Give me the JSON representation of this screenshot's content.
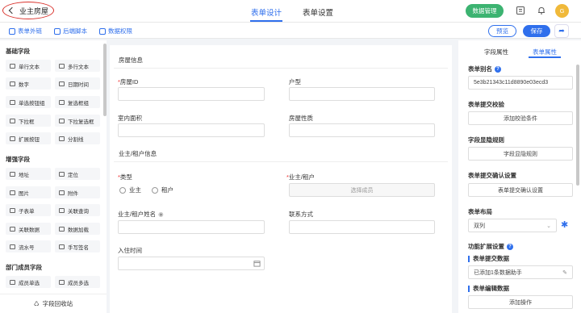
{
  "header": {
    "back_label": "业主房屋",
    "tab_form_design": "表单设计",
    "tab_form_settings": "表单设置",
    "data_mgmt": "数据管理",
    "avatar": "G"
  },
  "subbar": {
    "external_link": "表单外链",
    "backend_script": "后端脚本",
    "data_permission": "数据权限",
    "preview": "预览",
    "save": "保存"
  },
  "left": {
    "group_basic": "基础字段",
    "basic": [
      "单行文本",
      "多行文本",
      "数字",
      "日期时间",
      "单选按钮组",
      "复选框组",
      "下拉框",
      "下拉复选框",
      "扩展按钮",
      "分割线"
    ],
    "group_enhanced": "增强字段",
    "enhanced": [
      "地址",
      "定位",
      "图片",
      "附件",
      "子表单",
      "关联查询",
      "关联数据",
      "数据加载",
      "流水号",
      "手写签名"
    ],
    "group_member": "部门成员字段",
    "member": [
      "成员单选",
      "成员多选"
    ],
    "recycle": "字段回收站"
  },
  "canvas": {
    "section_house": "房屋信息",
    "house_id": "房屋ID",
    "layout": "户型",
    "indoor_area": "室内面积",
    "house_nature": "房屋性质",
    "section_owner": "业主/租户信息",
    "type": "类型",
    "radio_owner": "业主",
    "radio_tenant": "租户",
    "owner_tenant": "业主/租户",
    "select_member": "选择成员",
    "owner_name": "业主/租户姓名",
    "contact": "联系方式",
    "move_in": "入住时间"
  },
  "right": {
    "tab_field": "字段属性",
    "tab_form": "表单属性",
    "alias_label": "表单别名",
    "alias_value": "5e3b21343c11d8890e03ecd3",
    "validate_label": "表单提交校验",
    "validate_btn": "添加校验条件",
    "visibility_label": "字段显隐规则",
    "visibility_btn": "字段显隐规则",
    "confirm_label": "表单提交确认设置",
    "confirm_btn": "表单提交确认设置",
    "layout_label": "表单布局",
    "layout_value": "双列",
    "ext_label": "功能扩展设置",
    "submit_data": "表单提交数据",
    "submit_value": "已添加1条数据助手",
    "edit_data": "表单编辑数据",
    "add_op": "添加操作"
  }
}
